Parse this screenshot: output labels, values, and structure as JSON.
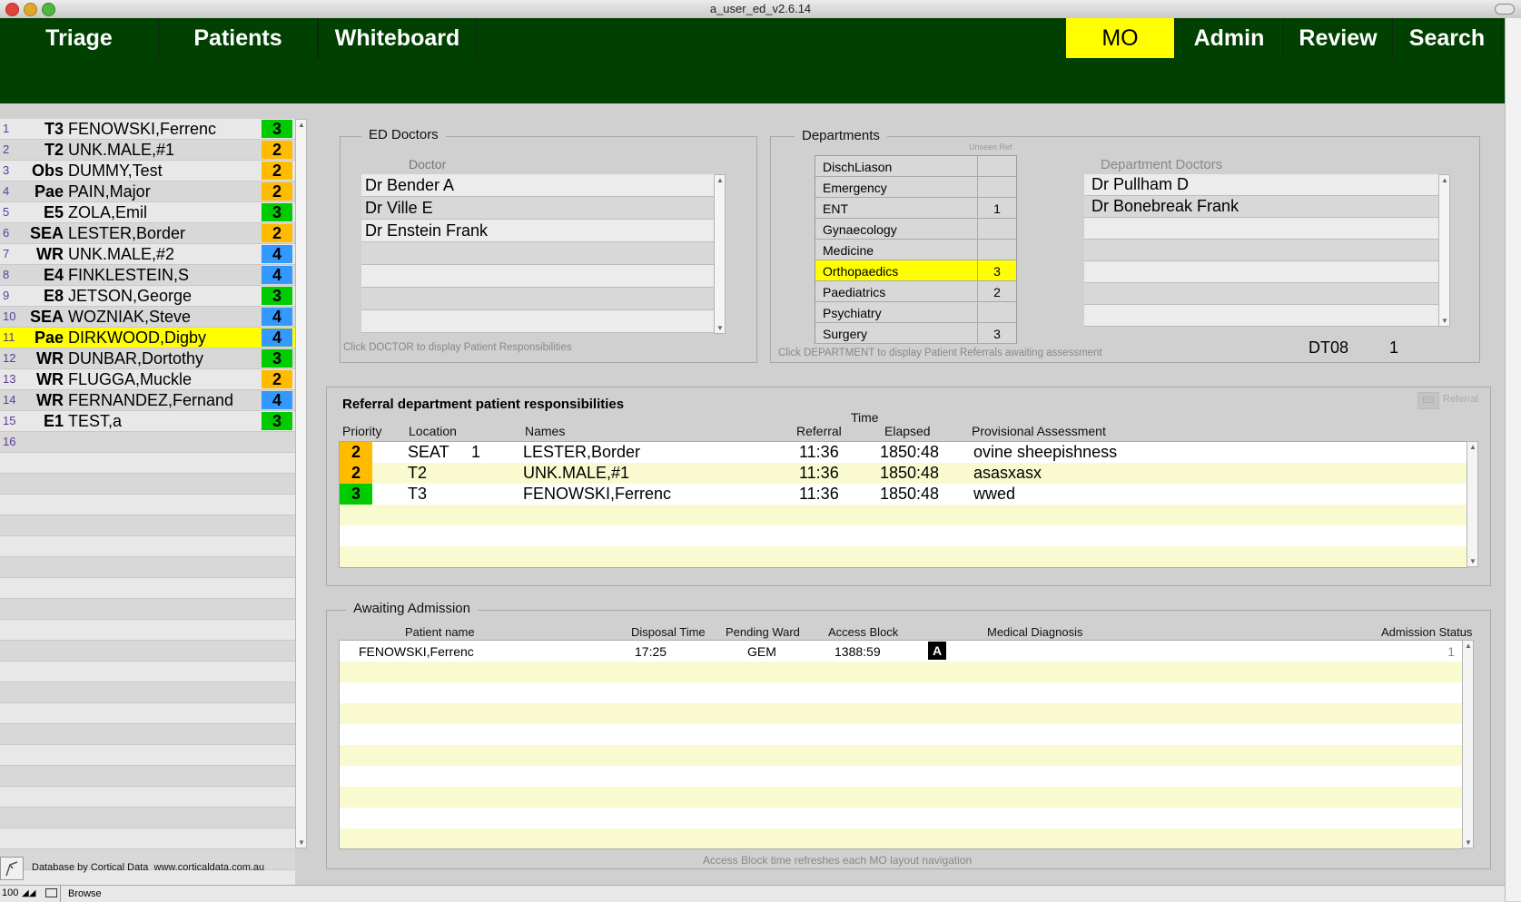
{
  "window": {
    "title": "a_user_ed_v2.6.14"
  },
  "colors": {
    "nav_bg": "#004000",
    "active": "#ffff00",
    "prio_green": "#00cc00",
    "prio_orange": "#ffbb00",
    "prio_blue": "#3399ff",
    "alt_yellow": "#fafad0"
  },
  "nav": {
    "left": [
      "Triage",
      "Patients",
      "Whiteboard"
    ],
    "right": [
      "MO",
      "Admin",
      "Review",
      "Search"
    ],
    "active": "MO"
  },
  "patients": [
    {
      "num": "1",
      "loc": "T3",
      "name": "FENOWSKI,Ferrenc",
      "prio": "3",
      "color": "green"
    },
    {
      "num": "2",
      "loc": "T2",
      "name": "UNK.MALE,#1",
      "prio": "2",
      "color": "orange"
    },
    {
      "num": "3",
      "loc": "Obs",
      "name": "DUMMY,Test",
      "prio": "2",
      "color": "orange"
    },
    {
      "num": "4",
      "loc": "Pae",
      "name": "PAIN,Major",
      "prio": "2",
      "color": "orange"
    },
    {
      "num": "5",
      "loc": "E5",
      "name": "ZOLA,Emil",
      "prio": "3",
      "color": "green"
    },
    {
      "num": "6",
      "loc": "SEA",
      "name": "LESTER,Border",
      "prio": "2",
      "color": "orange"
    },
    {
      "num": "7",
      "loc": "WR",
      "name": "UNK.MALE,#2",
      "prio": "4",
      "color": "blue"
    },
    {
      "num": "8",
      "loc": "E4",
      "name": "FINKLESTEIN,S",
      "prio": "4",
      "color": "blue"
    },
    {
      "num": "9",
      "loc": "E8",
      "name": "JETSON,George",
      "prio": "3",
      "color": "green"
    },
    {
      "num": "10",
      "loc": "SEA",
      "name": "WOZNIAK,Steve",
      "prio": "4",
      "color": "blue"
    },
    {
      "num": "11",
      "loc": "Pae",
      "name": "DIRKWOOD,Digby",
      "prio": "4",
      "color": "blue",
      "selected": true
    },
    {
      "num": "12",
      "loc": "WR",
      "name": "DUNBAR,Dortothy",
      "prio": "3",
      "color": "green"
    },
    {
      "num": "13",
      "loc": "WR",
      "name": "FLUGGA,Muckle",
      "prio": "2",
      "color": "orange"
    },
    {
      "num": "14",
      "loc": "WR",
      "name": "FERNANDEZ,Fernand",
      "prio": "4",
      "color": "blue"
    },
    {
      "num": "15",
      "loc": "E1",
      "name": "TEST,a",
      "prio": "3",
      "color": "green"
    },
    {
      "num": "16",
      "loc": "",
      "name": "",
      "prio": "",
      "color": ""
    }
  ],
  "ed_doctors": {
    "label": "ED Doctors",
    "column": "Doctor",
    "items": [
      "Dr Bender A",
      "Dr Ville E",
      "Dr Enstein Frank"
    ],
    "hint": "Click DOCTOR to display Patient Responsibilities"
  },
  "departments": {
    "label": "Departments",
    "unseen_label": "Unseen Ref",
    "items": [
      {
        "name": "DischLiason",
        "count": ""
      },
      {
        "name": "Emergency",
        "count": ""
      },
      {
        "name": "ENT",
        "count": "1"
      },
      {
        "name": "Gynaecology",
        "count": ""
      },
      {
        "name": "Medicine",
        "count": ""
      },
      {
        "name": "Orthopaedics",
        "count": "3",
        "selected": true
      },
      {
        "name": "Paediatrics",
        "count": "2"
      },
      {
        "name": "Psychiatry",
        "count": ""
      },
      {
        "name": "Surgery",
        "count": "3"
      }
    ],
    "hint": "Click DEPARTMENT to display Patient Referrals awaiting assessment",
    "doctors_column": "Department Doctors",
    "doctors": [
      "Dr Pullham D",
      "Dr Bonebreak Frank"
    ],
    "code": "DT08",
    "code_count": "1"
  },
  "referrals": {
    "title": "Referral department patient responsibilities",
    "toggle_ed": "ED",
    "toggle_referral": "Referral",
    "headers": {
      "priority": "Priority",
      "location": "Location",
      "names": "Names",
      "time": "Time",
      "referral": "Referral",
      "elapsed": "Elapsed",
      "assessment": "Provisional Assessment"
    },
    "rows": [
      {
        "prio": "2",
        "color": "orange",
        "loc": "SEAT",
        "bed": "1",
        "name": "LESTER,Border",
        "referral": "11:36",
        "elapsed": "1850:48",
        "assessment": "ovine sheepishness"
      },
      {
        "prio": "2",
        "color": "orange",
        "loc": "T2",
        "bed": "",
        "name": "UNK.MALE,#1",
        "referral": "11:36",
        "elapsed": "1850:48",
        "assessment": "asasxasx"
      },
      {
        "prio": "3",
        "color": "green",
        "loc": "T3",
        "bed": "",
        "name": "FENOWSKI,Ferrenc",
        "referral": "11:36",
        "elapsed": "1850:48",
        "assessment": "wwed"
      }
    ]
  },
  "admission": {
    "label": "Awaiting Admission",
    "headers": {
      "name": "Patient name",
      "disposal": "Disposal Time",
      "ward": "Pending Ward",
      "access": "Access Block",
      "diagnosis": "Medical Diagnosis",
      "status": "Admission Status"
    },
    "rows": [
      {
        "name": "FENOWSKI,Ferrenc",
        "disposal": "17:25",
        "ward": "GEM",
        "access": "1388:59",
        "badge": "A",
        "diagnosis": "",
        "status": "1"
      }
    ],
    "hint": "Access Block time refreshes each MO layout navigation"
  },
  "footer": {
    "credit": "Database by Cortical Data  www.corticaldata.com.au",
    "zoom": "100",
    "mode": "Browse"
  }
}
